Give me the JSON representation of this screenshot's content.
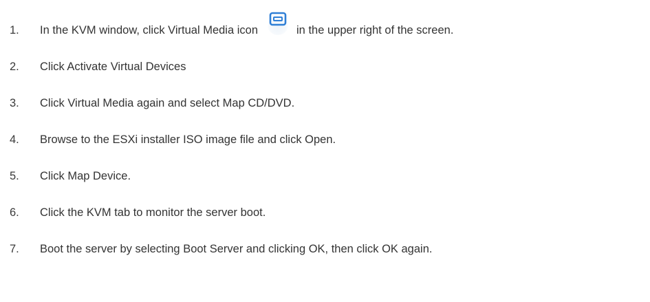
{
  "steps": [
    {
      "number": "1.",
      "text_before": "In the KVM window, click Virtual Media icon",
      "icon": "virtual-media-icon",
      "text_after": "in the upper right of the screen."
    },
    {
      "number": "2.",
      "text": "Click Activate Virtual Devices"
    },
    {
      "number": "3.",
      "text": "Click Virtual Media again and select Map CD/DVD."
    },
    {
      "number": "4.",
      "text": "Browse to the ESXi installer ISO image file and click Open."
    },
    {
      "number": "5.",
      "text": "Click Map Device."
    },
    {
      "number": "6.",
      "text": "Click the KVM tab to monitor the server boot."
    },
    {
      "number": "7.",
      "text": "Boot the server by selecting Boot Server and clicking OK, then click OK again."
    }
  ],
  "colors": {
    "text": "#333333",
    "icon_blue": "#2f7fd6"
  }
}
